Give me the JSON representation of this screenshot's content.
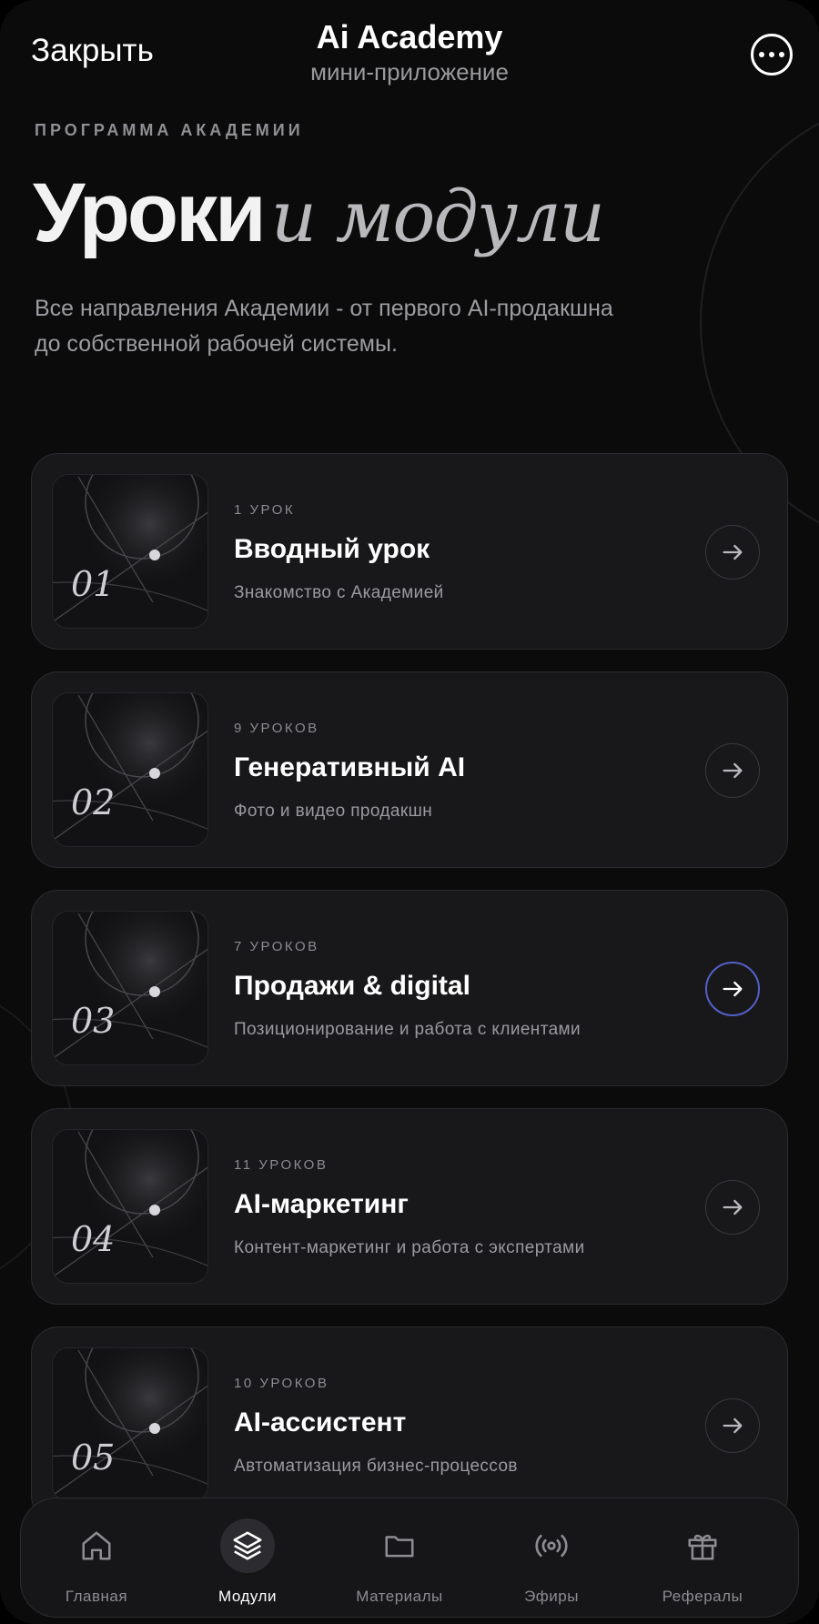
{
  "header": {
    "close_label": "Закрыть",
    "title": "Ai Academy",
    "subtitle": "мини-приложение",
    "more_icon": "more-horizontal-icon"
  },
  "hero": {
    "eyebrow": "ПРОГРАММА АКАДЕМИИ",
    "title_bold": "Уроки",
    "title_italic": "и модули",
    "description": "Все направления Академии - от первого AI-продакшна до собственной рабочей системы."
  },
  "modules": [
    {
      "number": "01",
      "meta": "1 УРОК",
      "title": "Вводный урок",
      "subtitle": "Знакомство с Академией",
      "active": false
    },
    {
      "number": "02",
      "meta": "9 УРОКОВ",
      "title": "Генеративный AI",
      "subtitle": "Фото и видео продакшн",
      "active": false
    },
    {
      "number": "03",
      "meta": "7 УРОКОВ",
      "title": "Продажи & digital",
      "subtitle": "Позиционирование и работа с клиентами",
      "active": true
    },
    {
      "number": "04",
      "meta": "11 УРОКОВ",
      "title": "AI-маркетинг",
      "subtitle": "Контент-маркетинг и работа с экспертами",
      "active": false
    },
    {
      "number": "05",
      "meta": "10 УРОКОВ",
      "title": "AI-ассистент",
      "subtitle": "Автоматизация бизнес-процессов",
      "active": false
    }
  ],
  "nav": {
    "items": [
      {
        "label": "Главная",
        "icon": "home-icon",
        "active": false
      },
      {
        "label": "Модули",
        "icon": "layers-icon",
        "active": true
      },
      {
        "label": "Материалы",
        "icon": "folder-icon",
        "active": false
      },
      {
        "label": "Эфиры",
        "icon": "broadcast-icon",
        "active": false
      },
      {
        "label": "Рефералы",
        "icon": "gift-icon",
        "active": false
      }
    ]
  },
  "colors": {
    "background": "#0b0b0c",
    "card": "#18181b",
    "accent_ring": "#5360c9",
    "muted_text": "#9a9a9f"
  }
}
